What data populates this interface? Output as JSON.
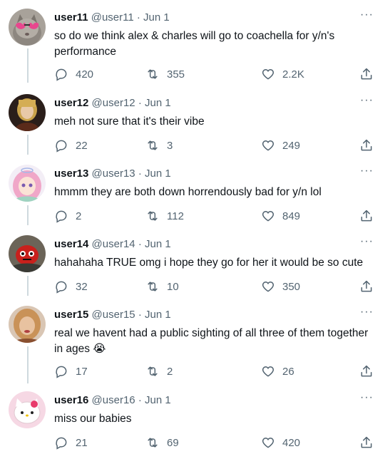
{
  "tweets": [
    {
      "name": "user11",
      "handle": "@user11",
      "dot": "·",
      "date": "Jun 1",
      "text": "so do we think alex & charles will go to coachella for y/n's performance",
      "replies": "420",
      "retweets": "355",
      "likes": "2.2K",
      "avatar_icon": "cat-with-heart-sunglasses"
    },
    {
      "name": "user12",
      "handle": "@user12",
      "dot": "·",
      "date": "Jun 1",
      "text": "meh not sure that it's their vibe",
      "replies": "22",
      "retweets": "3",
      "likes": "249",
      "avatar_icon": "dark-haired-figure"
    },
    {
      "name": "user13",
      "handle": "@user13",
      "dot": "·",
      "date": "Jun 1",
      "text": "hmmm they are both down horrendously bad for y/n lol",
      "replies": "2",
      "retweets": "112",
      "likes": "849",
      "avatar_icon": "anime-girl-pink-hair"
    },
    {
      "name": "user14",
      "handle": "@user14",
      "dot": "·",
      "date": "Jun 1",
      "text": "hahahaha TRUE omg i hope they go for her it would be so cute",
      "replies": "32",
      "retweets": "10",
      "likes": "350",
      "avatar_icon": "red-creature"
    },
    {
      "name": "user15",
      "handle": "@user15",
      "dot": "·",
      "date": "Jun 1",
      "text": "real we havent had a public sighting of all three of them together in ages 😭",
      "replies": "17",
      "retweets": "2",
      "likes": "26",
      "avatar_icon": "blonde-woman"
    },
    {
      "name": "user16",
      "handle": "@user16",
      "dot": "·",
      "date": "Jun 1",
      "text": "miss our babies",
      "replies": "21",
      "retweets": "69",
      "likes": "420",
      "avatar_icon": "hello-kitty"
    }
  ],
  "icons": {
    "more": "more-dots-icon",
    "reply": "reply-icon",
    "retweet": "retweet-icon",
    "like": "heart-icon",
    "share": "share-icon"
  },
  "colors": {
    "text": "#0f1419",
    "secondary": "#536471",
    "thread_line": "#cfd9de"
  }
}
